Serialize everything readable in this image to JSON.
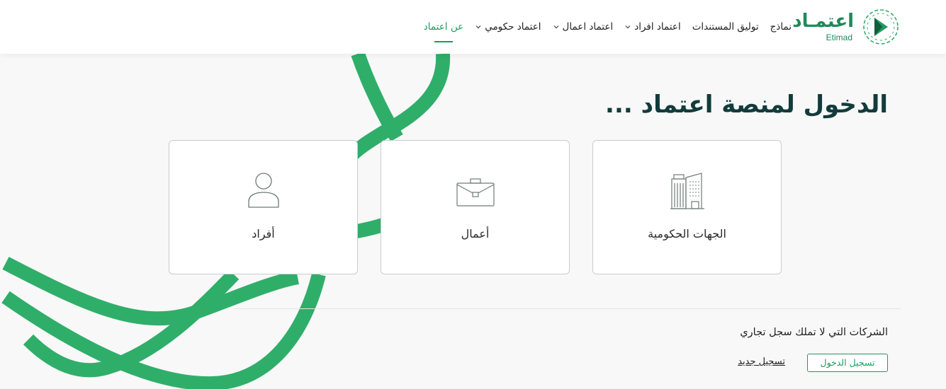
{
  "header": {
    "logo": {
      "ar": "اعتمـاد",
      "en": "Etimad"
    },
    "nav": [
      {
        "label": "عن اعتماد",
        "active": true,
        "has_dropdown": false
      },
      {
        "label": "اعتماد حكومي",
        "active": false,
        "has_dropdown": true
      },
      {
        "label": "اعتماد اعمال",
        "active": false,
        "has_dropdown": true
      },
      {
        "label": "اعتماد افراد",
        "active": false,
        "has_dropdown": true
      },
      {
        "label": "توليق المستندات",
        "active": false,
        "has_dropdown": false
      },
      {
        "label": "نماذج",
        "active": false,
        "has_dropdown": false
      }
    ]
  },
  "main": {
    "title": "الدخول لمنصة اعتماد ...",
    "cards": [
      {
        "label": "الجهات الحكومية",
        "icon": "government-building-icon"
      },
      {
        "label": "أعمال",
        "icon": "briefcase-icon"
      },
      {
        "label": "أفراد",
        "icon": "person-icon"
      }
    ]
  },
  "footer": {
    "no_cr_text": "الشركات التي لا تملك سجل تجاري",
    "login_label": "تسجيل الدخول",
    "register_label": "تسجيل جديد"
  },
  "colors": {
    "brand_green": "#1e9a5f",
    "ribbon_green": "#2fae6a",
    "title_dark": "#133b3b",
    "page_bg": "#f7f8f7"
  }
}
